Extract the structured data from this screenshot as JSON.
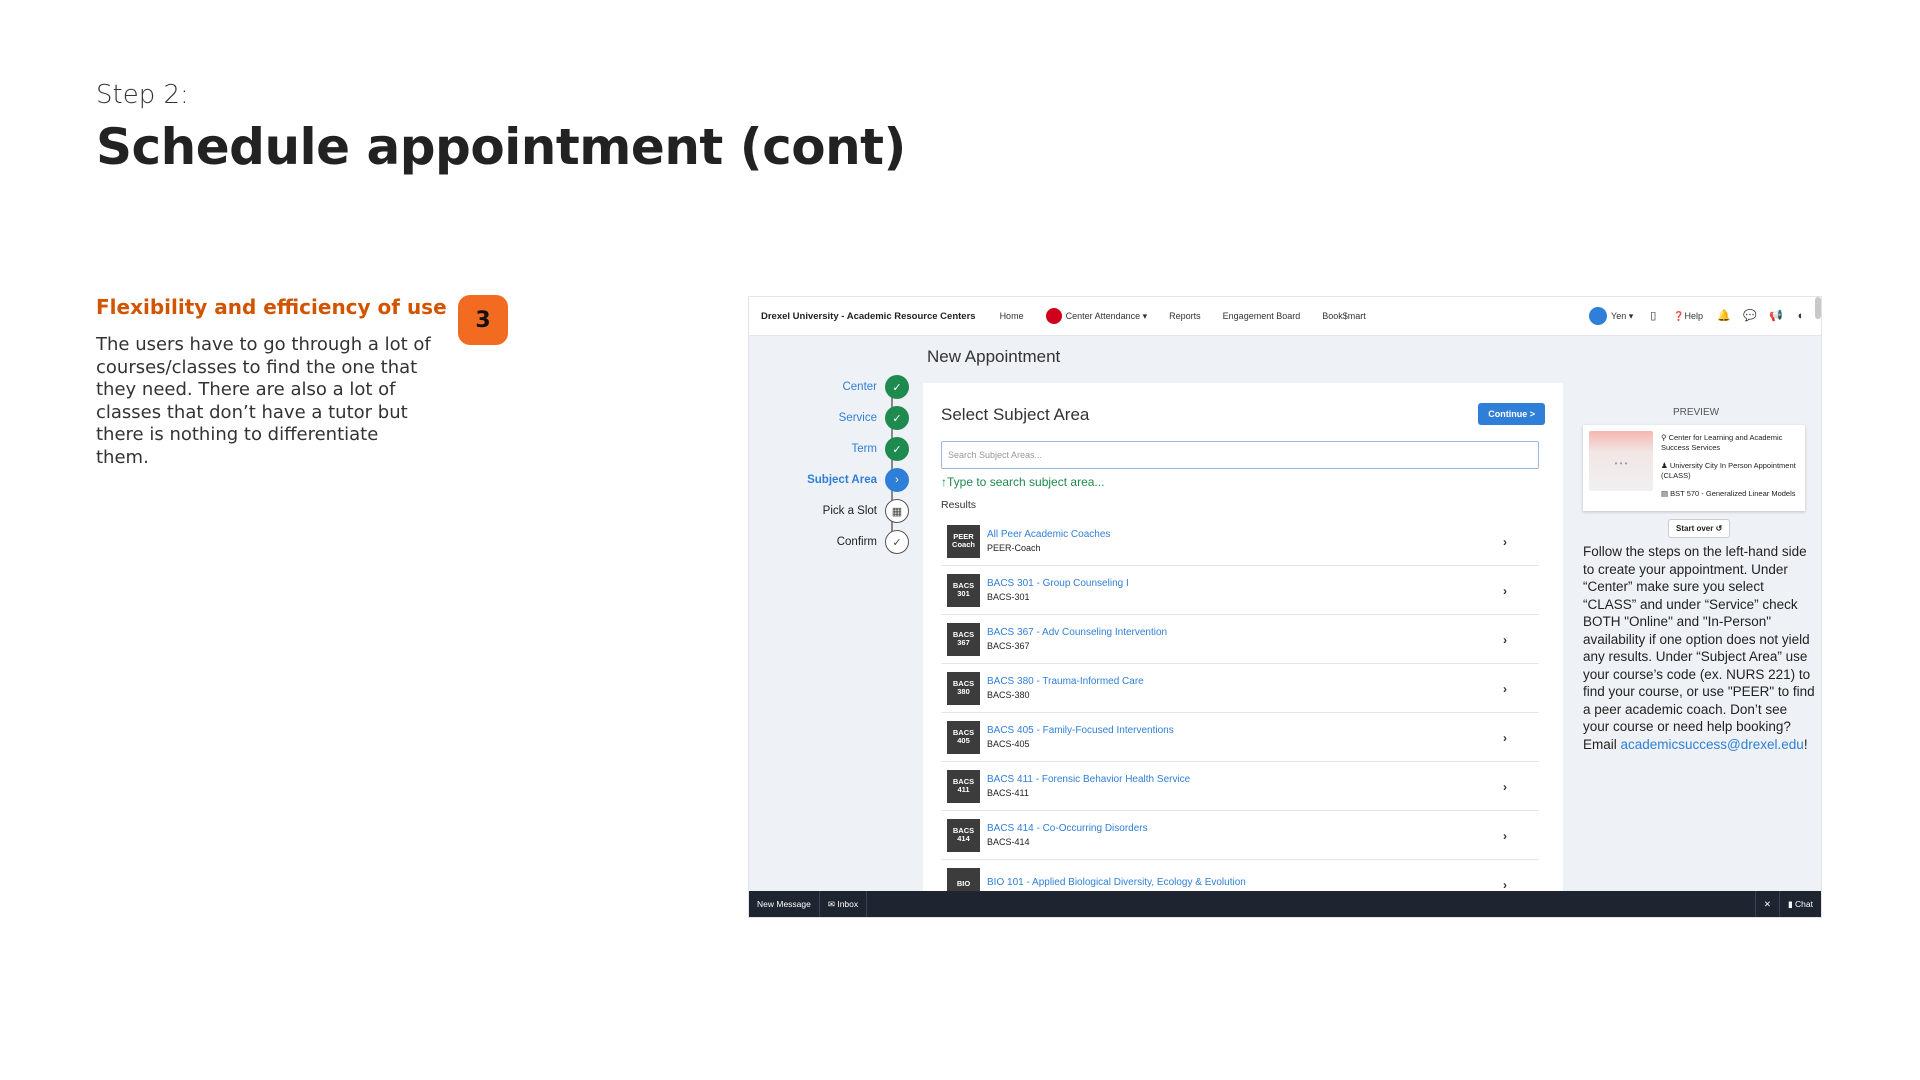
{
  "slide": {
    "step": "Step 2:",
    "title": "Schedule appointment (cont)",
    "heuristic_title": "Flexibility and efficiency of use",
    "heuristic_body": "The users have to go through a lot of courses/classes to find the one that they need. There are also a lot of classes that don’t have a tutor but there is nothing to differentiate them.",
    "badge_number": "3"
  },
  "app": {
    "nav": {
      "brand": "Drexel University - Academic Resource Centers",
      "links": [
        "Home",
        "Center Attendance ▾",
        "Reports",
        "Engagement Board",
        "Book$mart"
      ],
      "user": "Yen ▾",
      "help": "Help"
    },
    "page_title": "New Appointment",
    "stepper": [
      {
        "label": "Center",
        "state": "done"
      },
      {
        "label": "Service",
        "state": "done"
      },
      {
        "label": "Term",
        "state": "done"
      },
      {
        "label": "Subject Area",
        "state": "current"
      },
      {
        "label": "Pick a Slot",
        "state": "todo"
      },
      {
        "label": "Confirm",
        "state": "todo"
      }
    ],
    "card": {
      "title": "Select Subject Area",
      "continue_label": "Continue >",
      "search_placeholder": "Search Subject Areas...",
      "hint": "Type to search subject area...",
      "results_label": "Results",
      "items": [
        {
          "badge": "PEER\nCoach",
          "name": "All Peer Academic Coaches",
          "code": "PEER-Coach"
        },
        {
          "badge": "BACS\n301",
          "name": "BACS 301 - Group Counseling I",
          "code": "BACS-301"
        },
        {
          "badge": "BACS\n367",
          "name": "BACS 367 - Adv Counseling Intervention",
          "code": "BACS-367"
        },
        {
          "badge": "BACS\n380",
          "name": "BACS 380 - Trauma-Informed Care",
          "code": "BACS-380"
        },
        {
          "badge": "BACS\n405",
          "name": "BACS 405 - Family-Focused Interventions",
          "code": "BACS-405"
        },
        {
          "badge": "BACS\n411",
          "name": "BACS 411 - Forensic Behavior Health Service",
          "code": "BACS-411"
        },
        {
          "badge": "BACS\n414",
          "name": "BACS 414 - Co-Occurring Disorders",
          "code": "BACS-414"
        },
        {
          "badge": "BIO",
          "name": "BIO 101 - Applied Biological Diversity, Ecology & Evolution",
          "code": ""
        }
      ]
    },
    "preview": {
      "label": "PREVIEW",
      "center": "Center for Learning and Academic Success Services",
      "service": "University City In Person Appointment (CLASS)",
      "subject": "BST 570 - Generalized Linear Models",
      "start_over": "Start over",
      "help_text": "Follow the steps on the left-hand side to create your appointment. Under “Center” make sure you select “CLASS” and under “Service” check BOTH \"Online\" and \"In-Person\" availability if one option does not yield any results. Under “Subject Area” use your course’s code (ex. NURS 221) to find your course, or use \"PEER\" to find a peer academic coach. Don’t see your course or need help booking? Email ",
      "help_email": "academicsuccess@drexel.edu",
      "help_end": "!"
    },
    "bottom": {
      "new_message": "New Message",
      "inbox": "Inbox",
      "close": "✕",
      "chat": "Chat"
    }
  }
}
